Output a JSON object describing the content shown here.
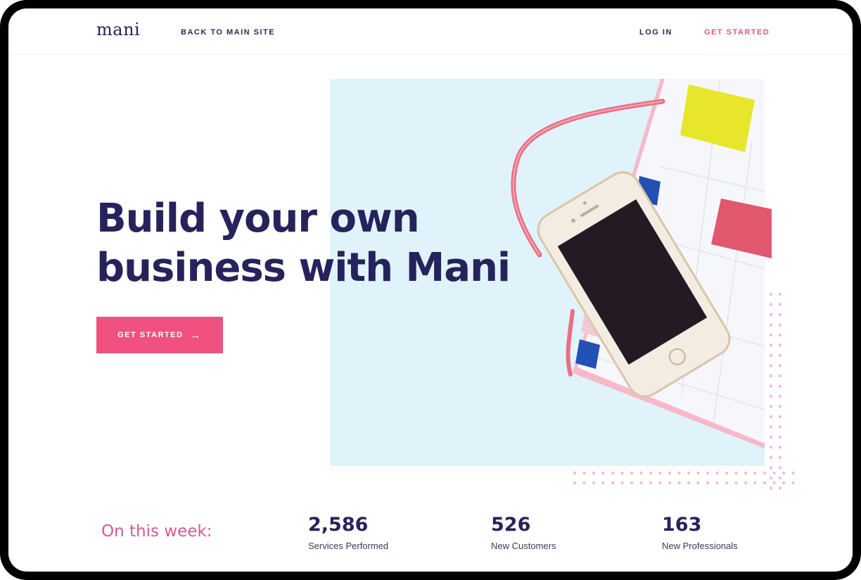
{
  "header": {
    "logo": "mani",
    "back_link": "BACK TO MAIN SITE",
    "login": "LOG IN",
    "get_started": "GET STARTED"
  },
  "hero": {
    "title_line1": "Build your own",
    "title_line2": "business with Mani",
    "cta_label": "GET STARTED",
    "cta_icon": "arrow-right-icon"
  },
  "stats": {
    "label": "On this week:",
    "items": [
      {
        "value": "2,586",
        "label": "Services Performed"
      },
      {
        "value": "526",
        "label": "New Customers"
      },
      {
        "value": "163",
        "label": "New Professionals"
      }
    ]
  },
  "colors": {
    "accent": "#f0517e",
    "navy": "#26235c",
    "hero_bg": "#e0f3fa",
    "stats_label": "#d85a8c"
  }
}
